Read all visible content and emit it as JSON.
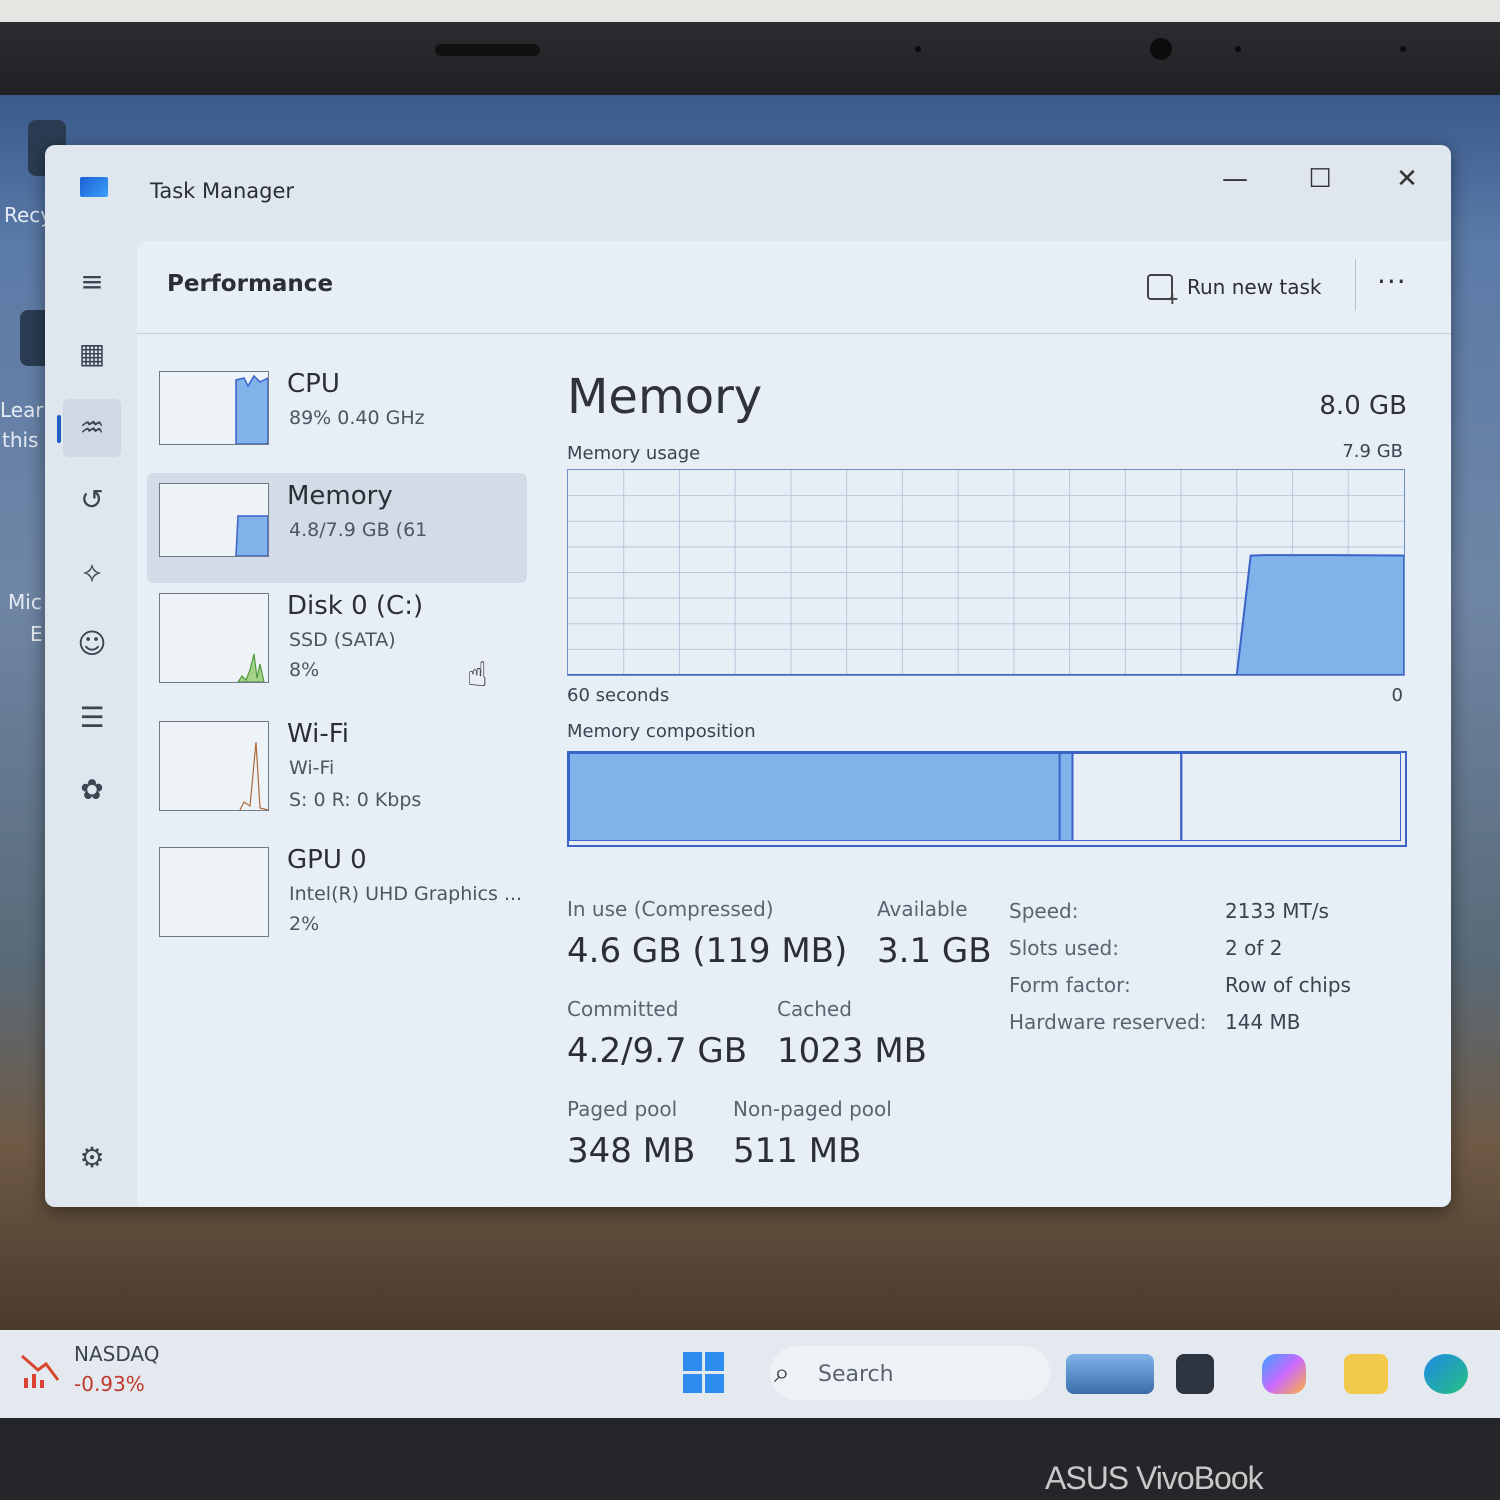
{
  "window": {
    "title": "Task Manager",
    "minimize": "—",
    "maximize": "☐",
    "close": "✕"
  },
  "header": {
    "title": "Performance",
    "run_new_task": "Run new task",
    "more": "···"
  },
  "desktop": {
    "labels": [
      "Recy",
      "Learn",
      "this",
      "Mic",
      "E"
    ]
  },
  "sidebar": {
    "icons": [
      "menu-icon",
      "processes-icon",
      "performance-icon",
      "app-history-icon",
      "startup-apps-icon",
      "users-icon",
      "details-icon",
      "services-icon",
      "settings-icon"
    ]
  },
  "perf_items": [
    {
      "name": "CPU",
      "line1": "89%  0.40 GHz",
      "line2": "",
      "usage_pct": 89
    },
    {
      "name": "Memory",
      "line1": "4.8/7.9 GB (61",
      "line2": "",
      "usage_pct": 61
    },
    {
      "name": "Disk 0 (C:)",
      "line1": "SSD (SATA)",
      "line2": "8%",
      "usage_pct": 8
    },
    {
      "name": "Wi-Fi",
      "line1": "Wi-Fi",
      "line2": "S: 0  R: 0 Kbps",
      "usage_pct": 0
    },
    {
      "name": "GPU 0",
      "line1": "Intel(R) UHD Graphics ...",
      "line2": "2%",
      "usage_pct": 2
    }
  ],
  "detail": {
    "title": "Memory",
    "total": "8.0 GB",
    "usage_label": "Memory usage",
    "usage_max": "7.9 GB",
    "time_left": "60 seconds",
    "time_right": "0",
    "composition_label": "Memory composition",
    "stats": {
      "in_use_label": "In use (Compressed)",
      "in_use_value": "4.6 GB (119 MB)",
      "available_label": "Available",
      "available_value": "3.1 GB",
      "committed_label": "Committed",
      "committed_value": "4.2/9.7 GB",
      "cached_label": "Cached",
      "cached_value": "1023 MB",
      "paged_label": "Paged pool",
      "paged_value": "348 MB",
      "nonpaged_label": "Non-paged pool",
      "nonpaged_value": "511 MB"
    },
    "specs": [
      {
        "label": "Speed:",
        "value": "2133 MT/s"
      },
      {
        "label": "Slots used:",
        "value": "2 of 2"
      },
      {
        "label": "Form factor:",
        "value": "Row of chips"
      },
      {
        "label": "Hardware reserved:",
        "value": "144 MB"
      }
    ]
  },
  "chart_data": {
    "type": "area",
    "x_range_seconds": [
      60,
      0
    ],
    "ylim_gb": [
      0,
      7.9
    ],
    "x": [
      60,
      12,
      11,
      10,
      5,
      0
    ],
    "y": [
      0,
      0,
      4.6,
      4.62,
      4.62,
      4.6
    ],
    "grid": true,
    "composition": {
      "in_use_gb": 4.6,
      "modified_gb": 0.12,
      "standby_gb": 1.02,
      "free_gb": 2.06
    }
  },
  "taskbar": {
    "stock_name": "NASDAQ",
    "stock_change": "-0.93%",
    "search_placeholder": "Search"
  },
  "brand": "ASUS VivoBook",
  "colors": {
    "accent": "#1f5fc4",
    "chart_fill": "#7fb3ea",
    "chart_line": "#3b63c9"
  }
}
